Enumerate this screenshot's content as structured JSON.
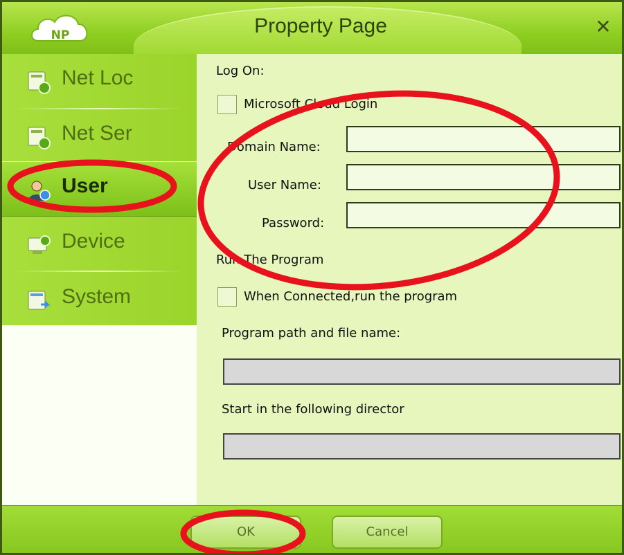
{
  "window": {
    "title": "Property Page",
    "logo_text": "NP",
    "close_glyph": "✕"
  },
  "sidebar": {
    "items": [
      {
        "label": "Net Loc",
        "icon": "net-location-icon"
      },
      {
        "label": "Net Ser",
        "icon": "net-service-icon"
      },
      {
        "label": "User",
        "icon": "user-icon",
        "active": true
      },
      {
        "label": "Device",
        "icon": "device-icon"
      },
      {
        "label": "System",
        "icon": "system-icon"
      }
    ]
  },
  "content": {
    "logon_heading": "Log On:",
    "cloud_login_label": "Microsoft Cloud Login",
    "domain_label": "Domain Name:",
    "user_label": "User Name:",
    "password_label": "Password:",
    "domain_value": "",
    "user_value": "",
    "password_value": "",
    "run_heading": "Run The Program",
    "run_when_connected_label": "When Connected,run the program",
    "program_path_label": "Program path and file name:",
    "program_path_value": "",
    "start_in_label": "Start in the following director",
    "start_in_value": ""
  },
  "buttons": {
    "ok": "OK",
    "cancel": "Cancel"
  },
  "colors": {
    "accent_green": "#8fcf22",
    "annotation_red": "#e8121c"
  }
}
